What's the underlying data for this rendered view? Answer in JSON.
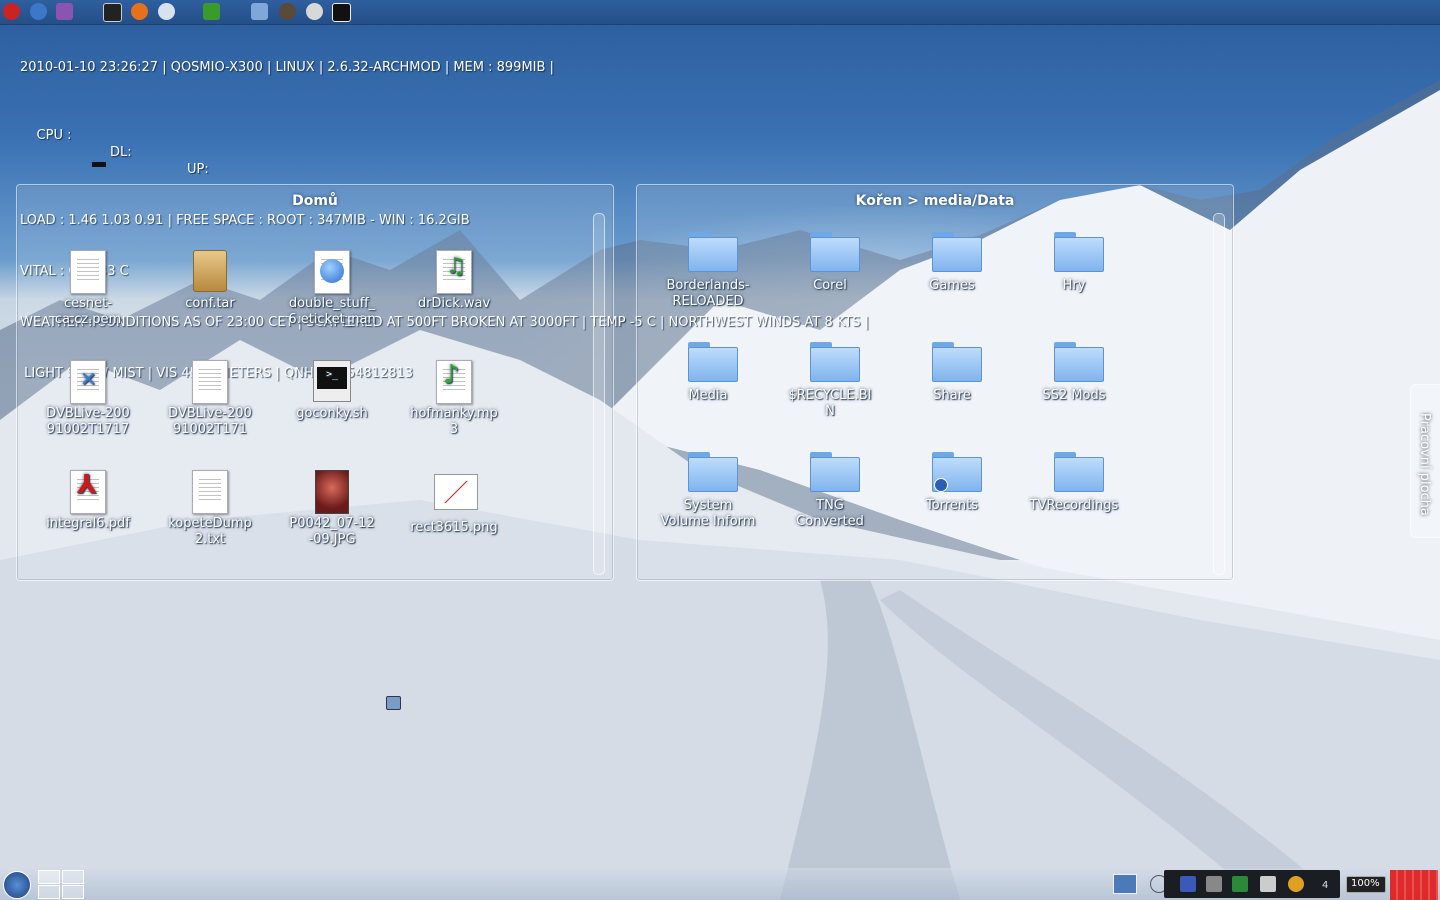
{
  "conky": {
    "line1": "2010-01-10 23:26:27 | QOSMIO-X300 | LINUX | 2.6.32-ARCHMOD | MEM : 899MIB |",
    "cpu_label": "CPU :",
    "dl_label": "DL:",
    "up_label": "UP:",
    "line3": "LOAD : 1.46 1.03 0.91 | FREE SPACE : ROOT : 347MIB - WIN : 16.2GIB",
    "line4": "VITAL : CPU 43 C",
    "line5": "WEATHER : CONDITIONS AS OF 23:00 CET | SCATTERED AT 500FT BROKEN AT 3000FT | TEMP -5 C | NORTHWEST WINDS AT 8 KTS |",
    "line6": " LIGHT SNOW MIST | VIS 4500 METERS | QNH 29.854812813"
  },
  "home_panel": {
    "title": "Domů",
    "items": [
      {
        "label": "cesnet-\nca.cz.pem",
        "icon": "text-document-icon"
      },
      {
        "label": "conf.tar",
        "icon": "archive-icon"
      },
      {
        "label": "double_stuff_\n6.eticket_nan",
        "icon": "web-document-icon"
      },
      {
        "label": "drDick.wav",
        "icon": "audio-file-icon"
      },
      {
        "label": "DVBLive-200\n91002T1717",
        "icon": "video-file-icon"
      },
      {
        "label": "DVBLive-200\n91002T171",
        "icon": "text-document-icon"
      },
      {
        "label": "goconky.sh",
        "icon": "terminal-script-icon"
      },
      {
        "label": "hofmanky.mp\n3",
        "icon": "music-file-icon"
      },
      {
        "label": "integral6.pdf",
        "icon": "pdf-icon"
      },
      {
        "label": "kopeteDump\n2.txt",
        "icon": "text-document-icon"
      },
      {
        "label": "P0042_07-12\n-09.JPG",
        "icon": "photo-thumbnail-icon"
      },
      {
        "label": "rect3615.png",
        "icon": "image-file-icon"
      }
    ]
  },
  "data_panel": {
    "title": "Kořen > media/Data",
    "items": [
      {
        "label": "Borderlands-\nRELOADED"
      },
      {
        "label": "Corel"
      },
      {
        "label": "Games"
      },
      {
        "label": "Hry"
      },
      {
        "label": "Media"
      },
      {
        "label": "$RECYCLE.BI\nN"
      },
      {
        "label": "Share"
      },
      {
        "label": "SS2 Mods"
      },
      {
        "label": "System\nVolume Inform"
      },
      {
        "label": "TNG\nConverted"
      },
      {
        "label": "Torrents"
      },
      {
        "label": "TVRecordings"
      }
    ]
  },
  "side_tab": {
    "label": "Pracovní plocha"
  },
  "tray": {
    "desktop_number": "4",
    "battery": "100%"
  }
}
